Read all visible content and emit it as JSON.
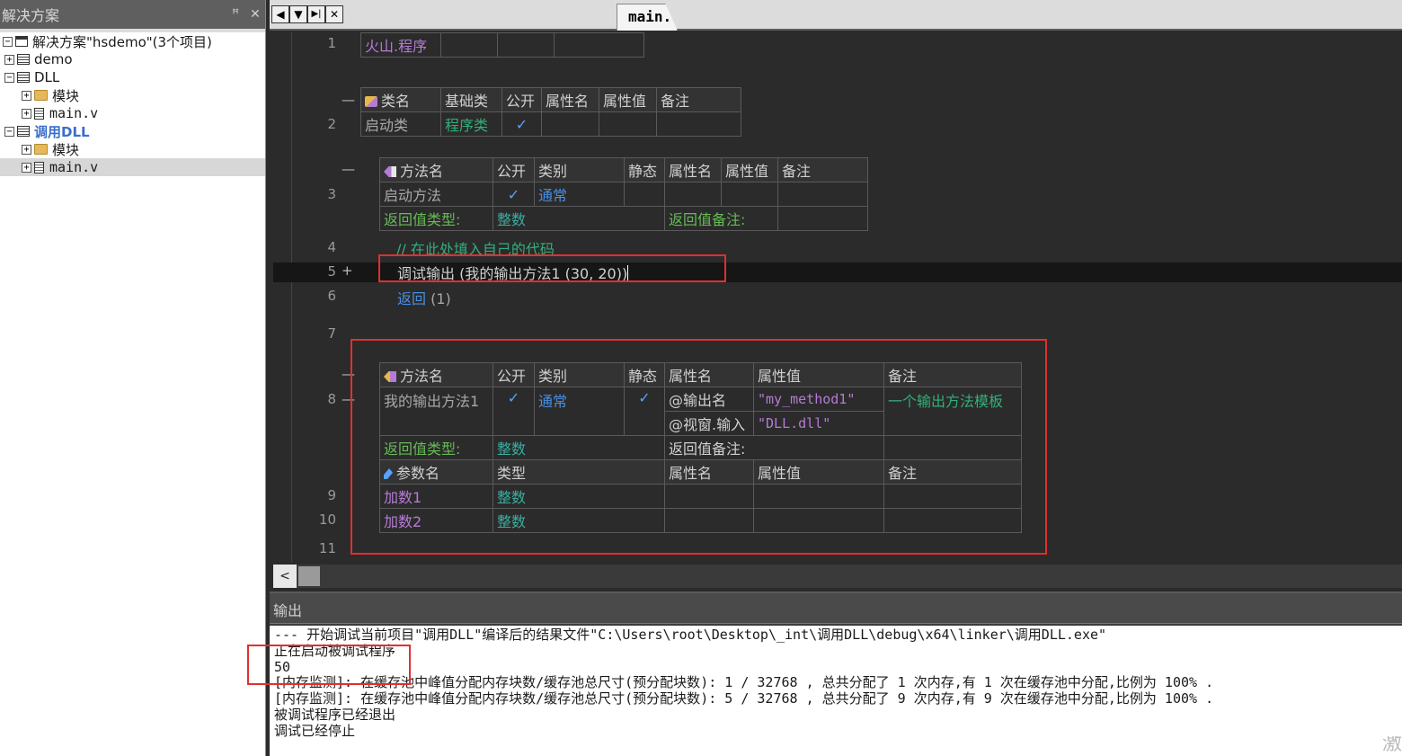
{
  "sidebar": {
    "title": "解决方案",
    "pin_glyph": "ꟸ",
    "close_glyph": "✕",
    "tree": [
      {
        "expander": "⊟",
        "icon": "solution",
        "label": "解决方案\"hsdemo\"(3个项目)"
      },
      {
        "expander": "⊞",
        "icon": "project",
        "label": "demo"
      },
      {
        "expander": "⊟",
        "icon": "project",
        "label": "DLL"
      },
      {
        "expander": "⊞",
        "icon": "folder",
        "label": "模块"
      },
      {
        "expander": "⊞",
        "icon": "file",
        "label": "main.v"
      },
      {
        "expander": "⊟",
        "icon": "project",
        "label": "调用DLL"
      },
      {
        "expander": "⊞",
        "icon": "folder",
        "label": "模块"
      },
      {
        "expander": "⊞",
        "icon": "file",
        "label": "main.v"
      }
    ]
  },
  "tabs": {
    "nav_prev": "◀",
    "nav_down": "▼",
    "nav_next": "▶|",
    "nav_close": "✕",
    "active": "main.v"
  },
  "editor": {
    "line_numbers": [
      "1",
      "2",
      "3",
      "4",
      "5",
      "6",
      "7",
      "8",
      "9",
      "10",
      "11"
    ],
    "program_table": {
      "name": "火山.程序"
    },
    "class_table": {
      "headers": [
        "类名",
        "基础类",
        "公开",
        "属性名",
        "属性值",
        "备注"
      ],
      "row": {
        "name": "启动类",
        "base": "程序类",
        "public": "✓"
      }
    },
    "start_method": {
      "headers": [
        "方法名",
        "公开",
        "类别",
        "静态",
        "属性名",
        "属性值",
        "备注"
      ],
      "row": {
        "name": "启动方法",
        "public": "✓",
        "category": "通常"
      },
      "return_type_label": "返回值类型:",
      "return_type": "整数",
      "return_note_label": "返回值备注:"
    },
    "code": {
      "comment": "// 在此处填入自己的代码",
      "call": "调试输出 (我的输出方法1 (30, 20))",
      "return": "返回",
      "return_arg": "(1)"
    },
    "my_method": {
      "headers": [
        "方法名",
        "公开",
        "类别",
        "静态",
        "属性名",
        "属性值",
        "备注"
      ],
      "row": {
        "name": "我的输出方法1",
        "public": "✓",
        "category": "通常",
        "static": "✓",
        "attr1_name": "@输出名",
        "attr1_value": "\"my_method1\"",
        "attr2_name": "@视窗.输入",
        "attr2_value": "\"DLL.dll\"",
        "note": "一个输出方法模板"
      },
      "return_type_label": "返回值类型:",
      "return_type": "整数",
      "return_note_label": "返回值备注:",
      "param_headers": [
        "参数名",
        "类型",
        "属性名",
        "属性值",
        "备注"
      ],
      "params": [
        {
          "name": "加数1",
          "type": "整数"
        },
        {
          "name": "加数2",
          "type": "整数"
        }
      ]
    },
    "fold_glyphs": {
      "minus": "—",
      "plus": "+"
    }
  },
  "scrollbar": {
    "left_arrow": "<"
  },
  "output": {
    "title": "输出",
    "lines": [
      "--- 开始调试当前项目\"调用DLL\"编译后的结果文件\"C:\\Users\\root\\Desktop\\_int\\调用DLL\\debug\\x64\\linker\\调用DLL.exe\"",
      "正在启动被调试程序",
      "50",
      "[内存监测]: 在缓存池中峰值分配内存块数/缓存池总尺寸(预分配块数): 1 / 32768 , 总共分配了 1 次内存,有 1 次在缓存池中分配,比例为 100% .",
      "[内存监测]: 在缓存池中峰值分配内存块数/缓存池总尺寸(预分配块数): 5 / 32768 , 总共分配了 9 次内存,有 9 次在缓存池中分配,比例为 100% .",
      "被调试程序已经退出",
      "调试已经停止"
    ],
    "watermark": "激"
  }
}
